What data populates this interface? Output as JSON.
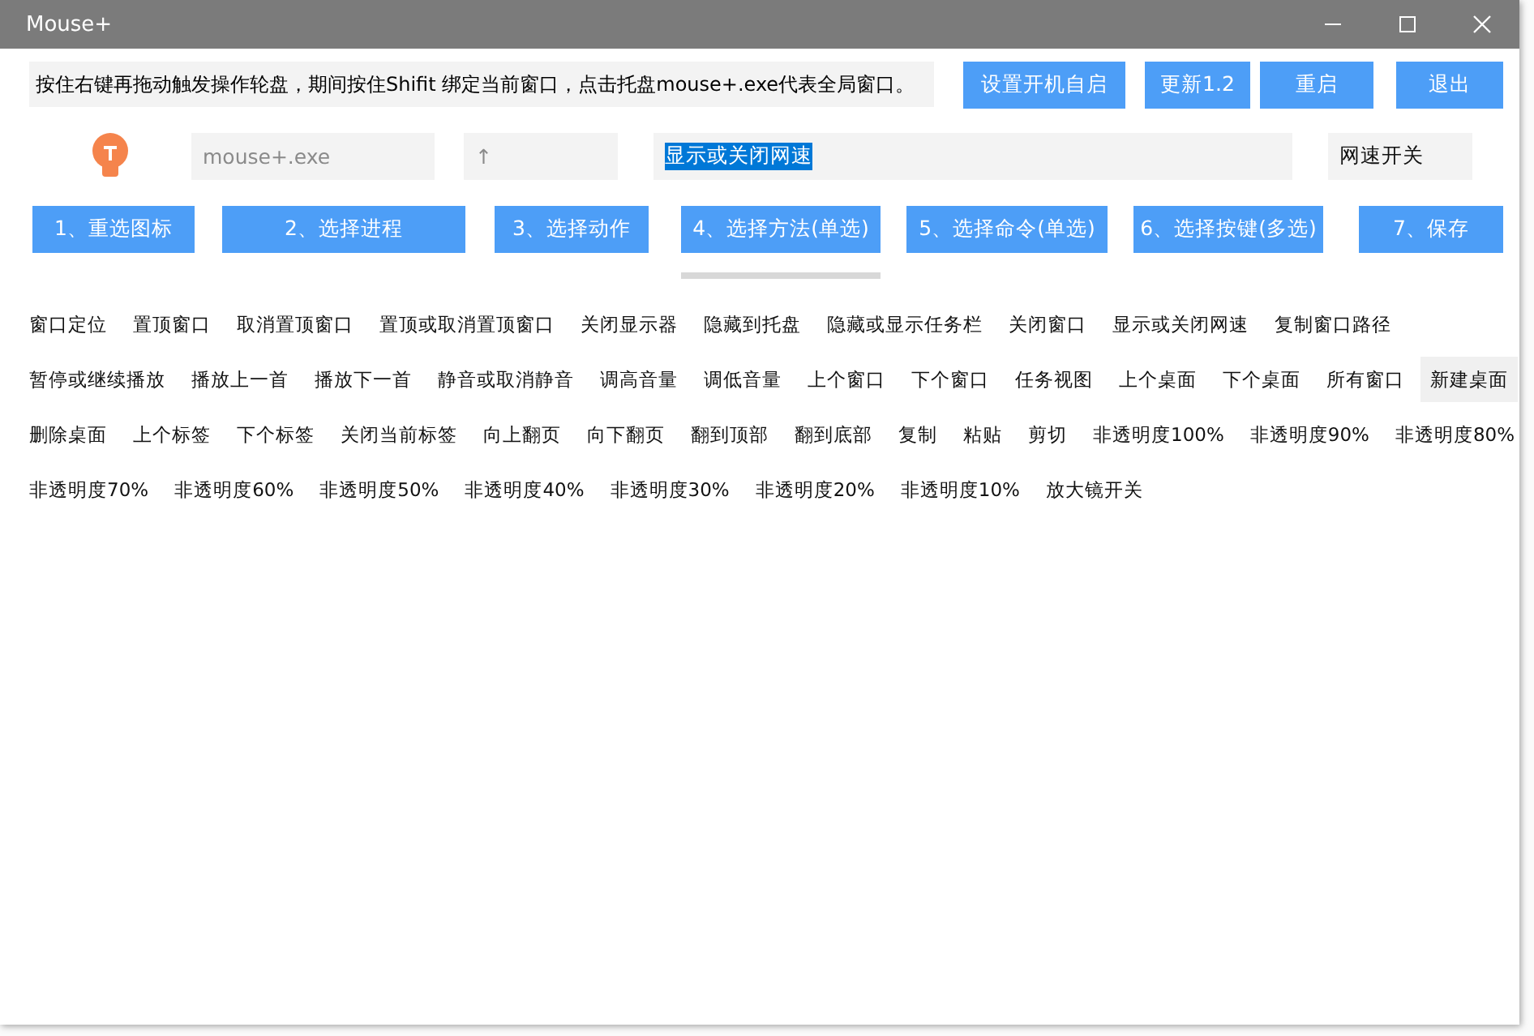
{
  "window": {
    "title": "Mouse+"
  },
  "instruction": "按住右键再拖动触发操作轮盘，期间按住Shifit 绑定当前窗口，点击托盘mouse+.exe代表全局窗口。",
  "top_buttons": [
    "设置开机自启",
    "更新1.2",
    "重启",
    "退出"
  ],
  "fields": [
    {
      "kind": "placeholder",
      "text": "mouse+.exe"
    },
    {
      "kind": "placeholder",
      "text": "↑"
    },
    {
      "kind": "selected",
      "text": "显示或关闭网速"
    },
    {
      "kind": "value",
      "text": "网速开关"
    }
  ],
  "steps": [
    {
      "label": "1、重选图标",
      "selected": false
    },
    {
      "label": "2、选择进程",
      "selected": false
    },
    {
      "label": "3、选择动作",
      "selected": false
    },
    {
      "label": "4、选择方法(单选)",
      "selected": true
    },
    {
      "label": "5、选择命令(单选)",
      "selected": false
    },
    {
      "label": "6、选择按键(多选)",
      "selected": false
    },
    {
      "label": "7、保存",
      "selected": false
    }
  ],
  "action_rows": [
    [
      {
        "label": "窗口定位",
        "selected": false
      },
      {
        "label": "置顶窗口",
        "selected": false
      },
      {
        "label": "取消置顶窗口",
        "selected": false
      },
      {
        "label": "置顶或取消置顶窗口",
        "selected": false
      },
      {
        "label": "关闭显示器",
        "selected": false
      },
      {
        "label": "隐藏到托盘",
        "selected": false
      },
      {
        "label": "隐藏或显示任务栏",
        "selected": false
      },
      {
        "label": "关闭窗口",
        "selected": false
      },
      {
        "label": "显示或关闭网速",
        "selected": false
      },
      {
        "label": "复制窗口路径",
        "selected": false
      }
    ],
    [
      {
        "label": "暂停或继续播放",
        "selected": false
      },
      {
        "label": "播放上一首",
        "selected": false
      },
      {
        "label": "播放下一首",
        "selected": false
      },
      {
        "label": "静音或取消静音",
        "selected": false
      },
      {
        "label": "调高音量",
        "selected": false
      },
      {
        "label": "调低音量",
        "selected": false
      },
      {
        "label": "上个窗口",
        "selected": false
      },
      {
        "label": "下个窗口",
        "selected": false
      },
      {
        "label": "任务视图",
        "selected": false
      },
      {
        "label": "上个桌面",
        "selected": false
      },
      {
        "label": "下个桌面",
        "selected": false
      },
      {
        "label": "所有窗口",
        "selected": false
      },
      {
        "label": "新建桌面",
        "selected": true
      }
    ],
    [
      {
        "label": "删除桌面",
        "selected": false
      },
      {
        "label": "上个标签",
        "selected": false
      },
      {
        "label": "下个标签",
        "selected": false
      },
      {
        "label": "关闭当前标签",
        "selected": false
      },
      {
        "label": "向上翻页",
        "selected": false
      },
      {
        "label": "向下翻页",
        "selected": false
      },
      {
        "label": "翻到顶部",
        "selected": false
      },
      {
        "label": "翻到底部",
        "selected": false
      },
      {
        "label": "复制",
        "selected": false
      },
      {
        "label": "粘贴",
        "selected": false
      },
      {
        "label": "剪切",
        "selected": false
      },
      {
        "label": "非透明度100%",
        "selected": false
      },
      {
        "label": "非透明度90%",
        "selected": false
      },
      {
        "label": "非透明度80%",
        "selected": false
      }
    ],
    [
      {
        "label": "非透明度70%",
        "selected": false
      },
      {
        "label": "非透明度60%",
        "selected": false
      },
      {
        "label": "非透明度50%",
        "selected": false
      },
      {
        "label": "非透明度40%",
        "selected": false
      },
      {
        "label": "非透明度30%",
        "selected": false
      },
      {
        "label": "非透明度20%",
        "selected": false
      },
      {
        "label": "非透明度10%",
        "selected": false
      },
      {
        "label": "放大镜开关",
        "selected": false
      }
    ]
  ]
}
